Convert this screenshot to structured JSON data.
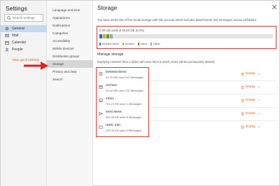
{
  "settings": {
    "title": "Settings",
    "search_placeholder": "Search settings",
    "nav": [
      {
        "label": "General",
        "icon": "gear-icon"
      },
      {
        "label": "Mail",
        "icon": "mail-icon"
      },
      {
        "label": "Calendar",
        "icon": "calendar-icon"
      },
      {
        "label": "People",
        "icon": "people-icon"
      }
    ],
    "quick_settings": "View quick settings"
  },
  "subnav": [
    {
      "label": "Language and time"
    },
    {
      "label": "Appearance"
    },
    {
      "label": "Notifications"
    },
    {
      "label": "Categories"
    },
    {
      "label": "Accessibility"
    },
    {
      "label": "Mobile devices"
    },
    {
      "label": "Distribution groups"
    },
    {
      "label": "Storage"
    },
    {
      "label": "Privacy and data"
    },
    {
      "label": "Search"
    }
  ],
  "storage": {
    "title": "Storage",
    "usage_text": "You have 49.50 GB of free email storage with this account which includes attachments and messages across all folders.",
    "used_text": "0.00 GB used of 49.50 GB (0.0%)",
    "bar_segments": [
      {
        "label": "Deleted Items",
        "color": "#2e66b8"
      },
      {
        "label": "Archive",
        "color": "#e0a820"
      },
      {
        "label": "Inbox",
        "color": "#6e8d3a"
      },
      {
        "label": "Other",
        "color": "#9aa5ad"
      }
    ],
    "manage_title": "Manage storage",
    "empty_note": "Emptying contents from a folder will move them to trash, items will be permanently deleted.",
    "empty_label": "Empty",
    "folders": [
      {
        "name": "Deleted Items",
        "meta": "31.20 MB used  210 Messages"
      },
      {
        "name": "Archive",
        "meta": "53.52 MB used  202 Messages"
      },
      {
        "name": "Inbox",
        "meta": "761.21 KB used  1 Messages"
      },
      {
        "name": "Sent Items",
        "meta": "553.40 KB used  6 Messages"
      },
      {
        "name": "ISDC Info",
        "meta": "225.39 KB used  2 Messages"
      }
    ]
  },
  "colors": {
    "accent": "#e0621b",
    "highlight": "#d63a3a",
    "selected_nav": "#c7d9ee"
  }
}
